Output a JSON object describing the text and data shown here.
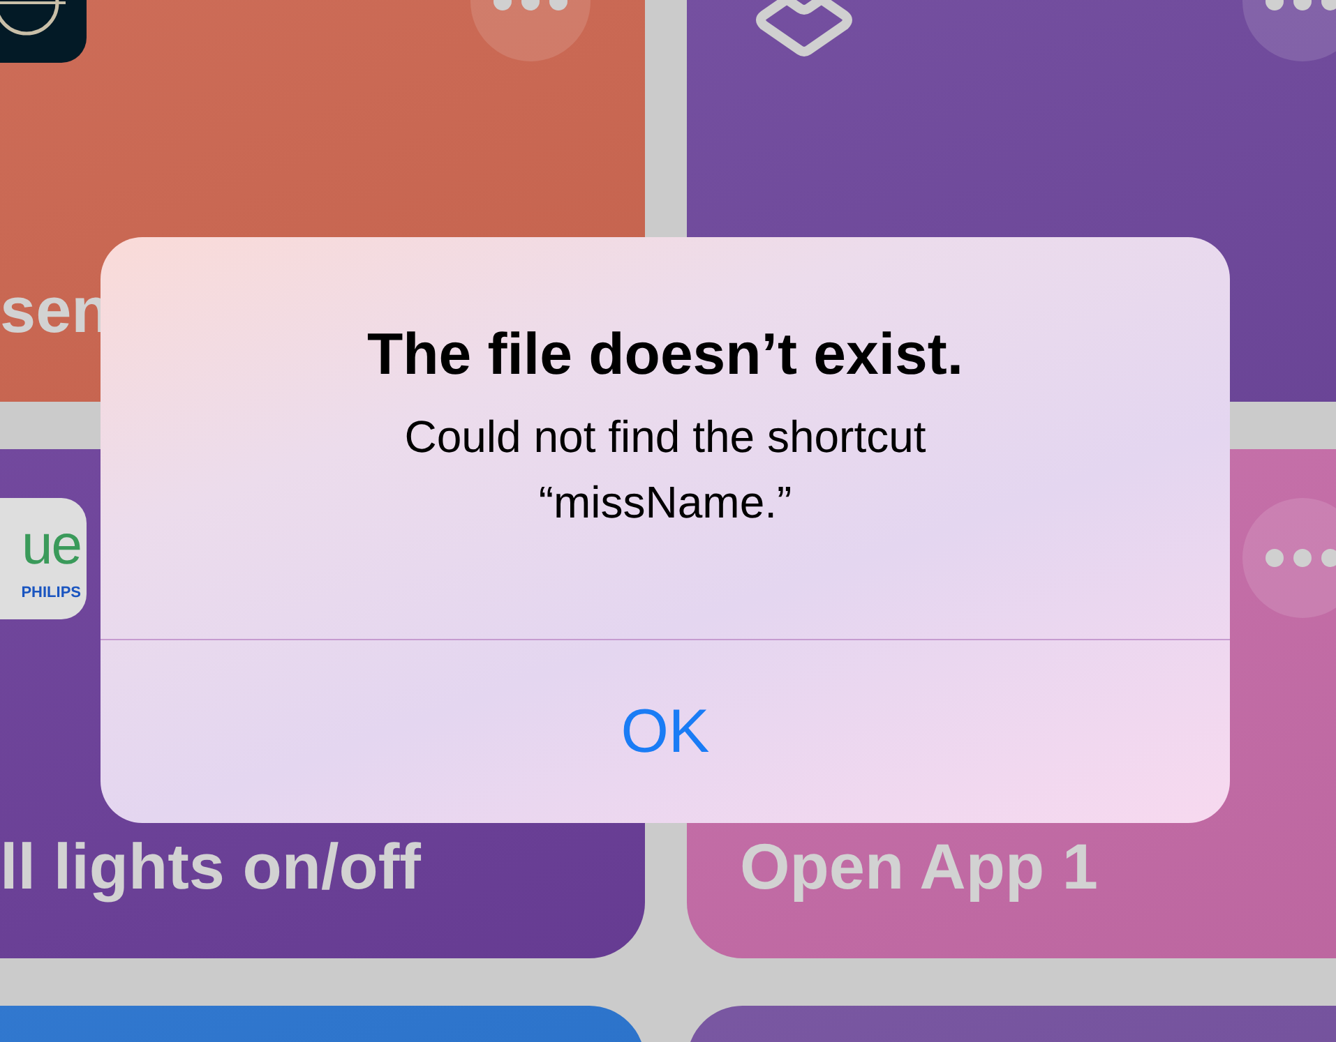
{
  "tiles": [
    {
      "kind": "dark-app",
      "label": "sen",
      "color": "#cc6650",
      "more_button": true
    },
    {
      "kind": "layers",
      "color": "#6e479c",
      "more_button": true
    },
    {
      "kind": "hue",
      "label": "ll lights on/off",
      "color": "#6a3e98",
      "icon_texts": [
        "ue",
        "PHILIPS"
      ]
    },
    {
      "kind": "none",
      "label": "Open App 1",
      "color": "#c46aa6",
      "more_button": true
    },
    {
      "kind": "none",
      "color": "#2570cc"
    },
    {
      "kind": "none",
      "color": "#714d9c"
    }
  ],
  "alert": {
    "title": "The file doesn’t exist.",
    "message_lines": [
      "Could not find the shortcut",
      "“missName.”"
    ],
    "buttons": [
      "OK"
    ]
  }
}
